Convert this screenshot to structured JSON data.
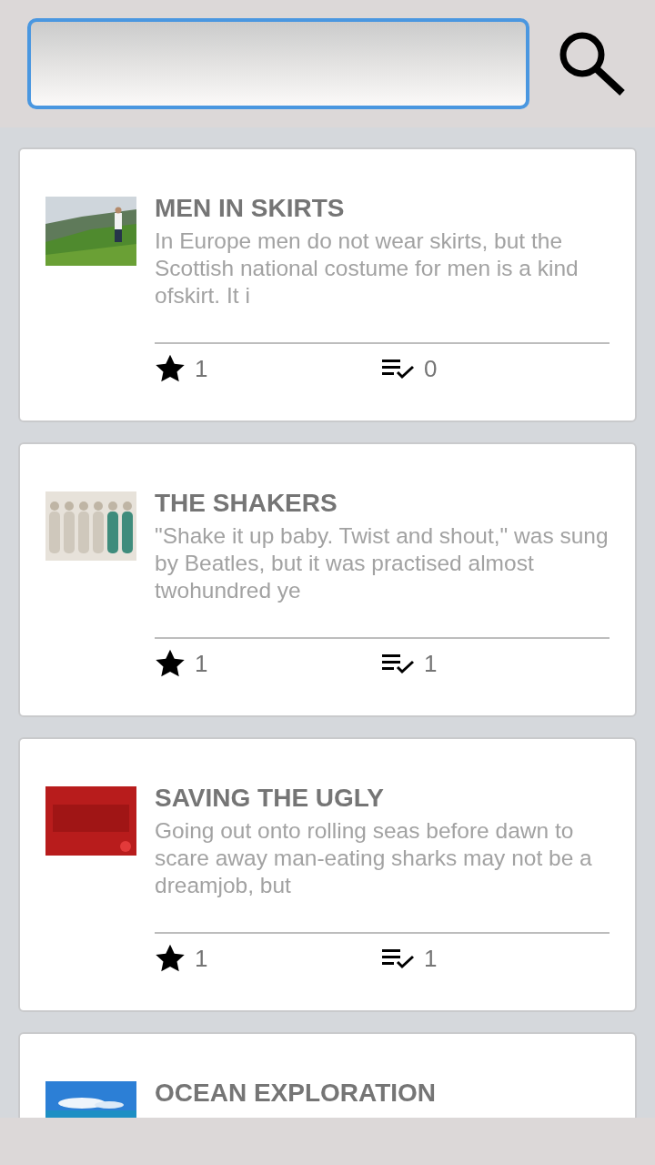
{
  "articles": [
    {
      "title": "MEN IN SKIRTS",
      "excerpt": "In Europe men do not wear skirts, but the Scottish national costume for men is a kind ofskirt. It i",
      "stars": "1",
      "checks": "0"
    },
    {
      "title": "THE SHAKERS",
      "excerpt": "\"Shake it up baby. Twist and shout,\" was sung by Beatles, but it was practised almost twohundred ye",
      "stars": "1",
      "checks": "1"
    },
    {
      "title": "SAVING THE UGLY",
      "excerpt": "Going out onto rolling seas before dawn to scare away man-eating sharks may not be a dreamjob, but",
      "stars": "1",
      "checks": "1"
    },
    {
      "title": "OCEAN EXPLORATION"
    }
  ]
}
